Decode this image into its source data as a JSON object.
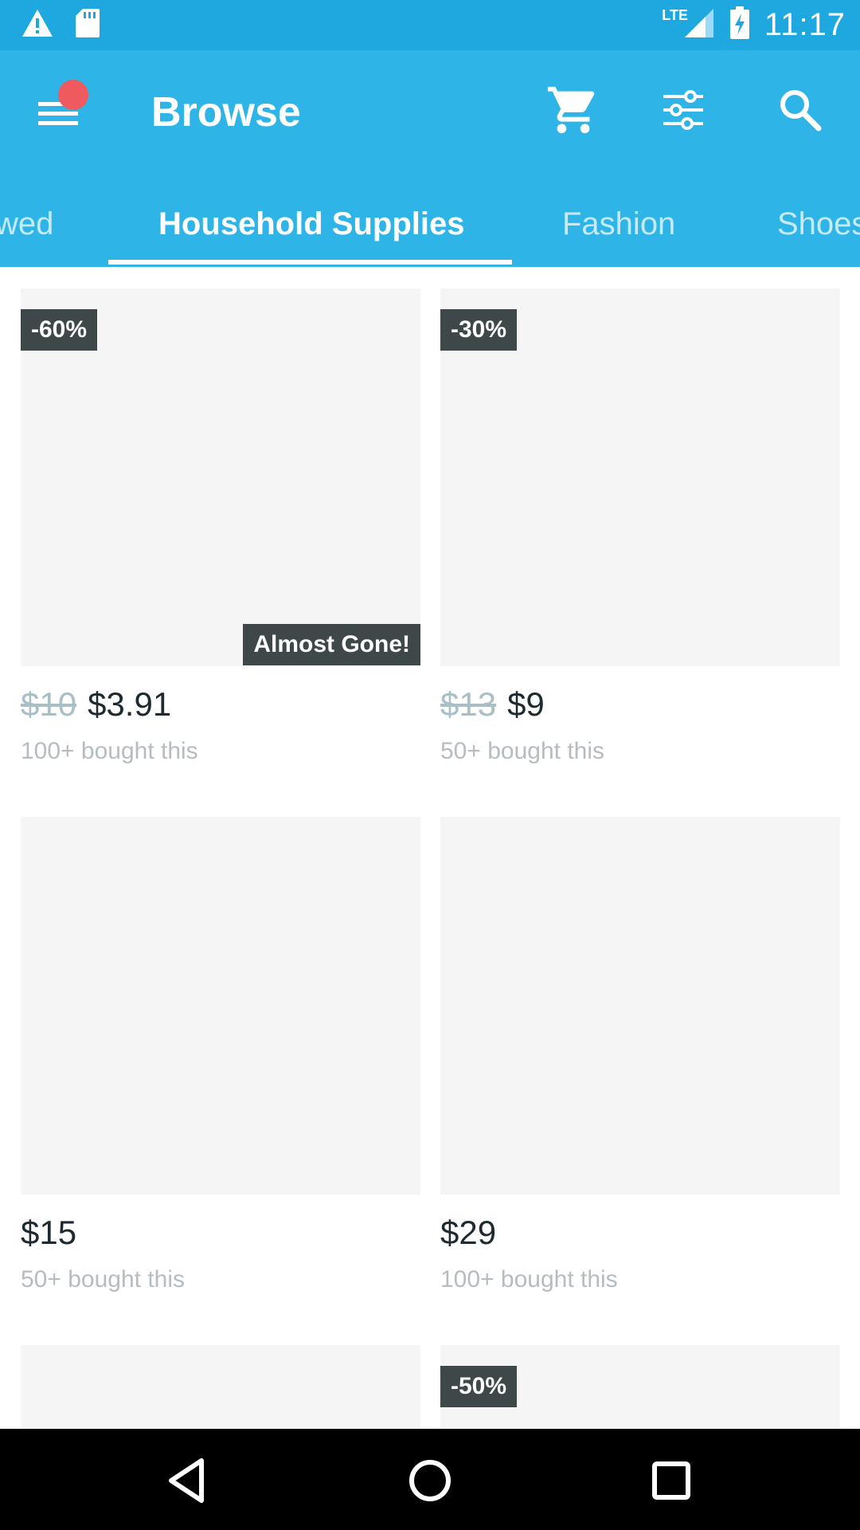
{
  "status_bar": {
    "time": "11:17",
    "network": "LTE",
    "icons": [
      "warning-icon",
      "sd-card-icon",
      "signal-icon",
      "battery-charging-icon"
    ]
  },
  "app_bar": {
    "title": "Browse",
    "actions": [
      "menu-icon",
      "cart-icon",
      "filter-icon",
      "search-icon"
    ],
    "notification_color": "#ef5a5e"
  },
  "tabs": {
    "items": [
      "wed",
      "Household Supplies",
      "Fashion",
      "Shoes"
    ],
    "active_index": 1
  },
  "products": [
    {
      "discount": "-60%",
      "tag": "Almost Gone!",
      "old_price": "$10",
      "price": "$3.91",
      "bought": "100+ bought this"
    },
    {
      "discount": "-30%",
      "old_price": "$13",
      "price": "$9",
      "bought": "50+ bought this"
    },
    {
      "price": "$15",
      "bought": "50+ bought this"
    },
    {
      "price": "$29",
      "bought": "100+ bought this"
    },
    {},
    {
      "discount": "-50%"
    }
  ],
  "colors": {
    "status_bar": "#1fa8e0",
    "app_bar": "#2fb4e8",
    "badge": "#3f4848",
    "old_price": "#a9bfc6"
  },
  "nav_bar": [
    "back-icon",
    "home-icon",
    "recents-icon"
  ]
}
